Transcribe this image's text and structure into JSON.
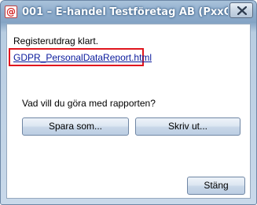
{
  "window": {
    "title": "001 – E-handel Testföretag AB (PxxO35…",
    "app_icon_glyph": "@"
  },
  "dialog": {
    "status": "Registerutdrag klart.",
    "file_link": "GDPR_PersonalDataReport.html",
    "question": "Vad vill du göra med rapporten?",
    "save_label": "Spara som...",
    "print_label": "Skriv ut...",
    "close_label": "Stäng"
  },
  "colors": {
    "highlight": "#e0161e",
    "link": "#0a1a9c"
  },
  "icons": {
    "app": "app-logo-icon",
    "close": "close-icon"
  }
}
